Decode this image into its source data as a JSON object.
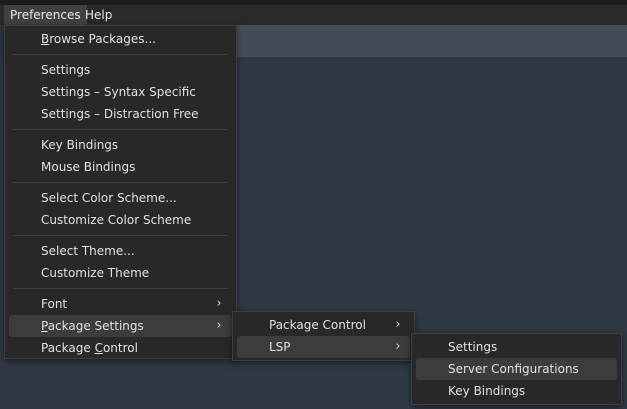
{
  "menubar": {
    "items": [
      {
        "label": "Preferences"
      },
      {
        "label": "Help"
      }
    ]
  },
  "preferences_menu": {
    "browse_packages": {
      "pre": "",
      "u": "B",
      "post": "rowse Packages..."
    },
    "settings": "Settings",
    "settings_syntax": "Settings – Syntax Specific",
    "settings_distraction": "Settings – Distraction Free",
    "key_bindings": "Key Bindings",
    "mouse_bindings": "Mouse Bindings",
    "select_color_scheme": "Select Color Scheme...",
    "customize_color_scheme": "Customize Color Scheme",
    "select_theme": "Select Theme...",
    "customize_theme": "Customize Theme",
    "font": "Font",
    "package_settings": {
      "pre": "",
      "u": "P",
      "post": "ackage Settings"
    },
    "package_control": {
      "pre": "Package ",
      "u": "C",
      "post": "ontrol"
    },
    "submenu_arrow": "›"
  },
  "package_settings_menu": {
    "package_control": "Package Control",
    "lsp": "LSP",
    "submenu_arrow": "›"
  },
  "lsp_menu": {
    "settings": "Settings",
    "server_configurations": "Server Configurations",
    "key_bindings": "Key Bindings"
  }
}
